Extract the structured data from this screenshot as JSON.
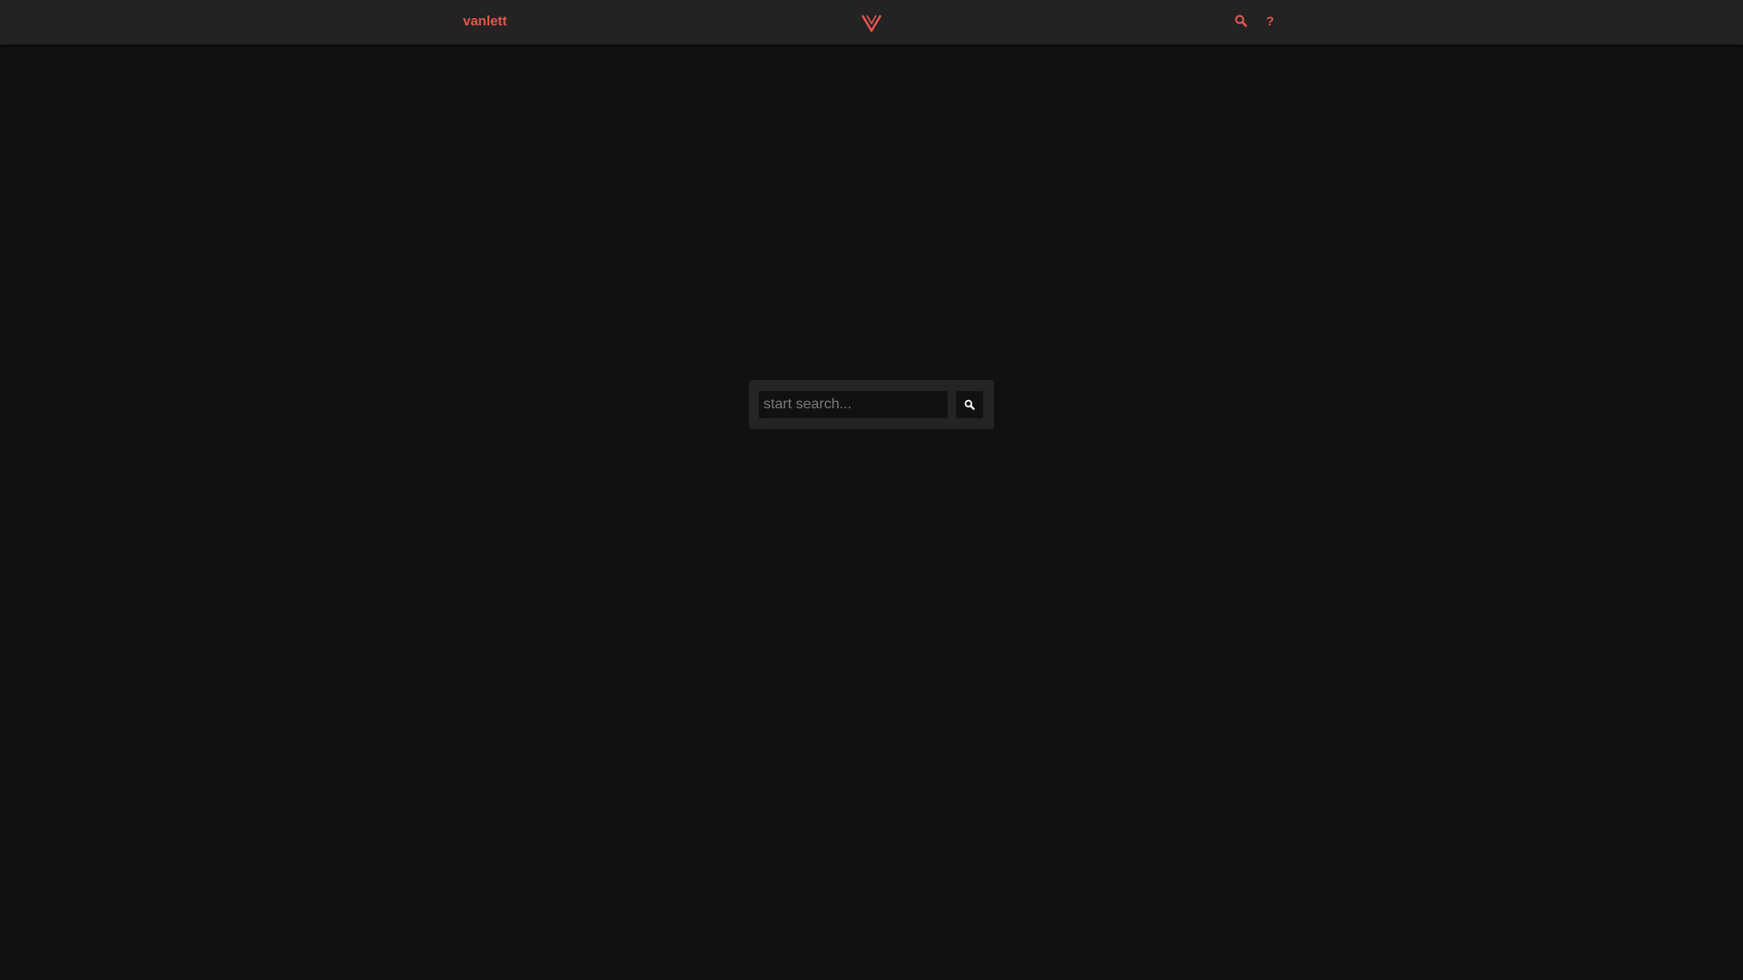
{
  "header": {
    "brand": "vanlett",
    "help_label": "?"
  },
  "search": {
    "placeholder": "start search...",
    "value": ""
  },
  "icons": {
    "logo": "v-logo-icon",
    "nav_search": "search-icon",
    "help": "help-icon",
    "button_search": "search-icon"
  },
  "colors": {
    "accent": "#e8554e",
    "header_bg": "#232323",
    "page_bg": "#111111",
    "search_panel_bg": "#242424"
  }
}
